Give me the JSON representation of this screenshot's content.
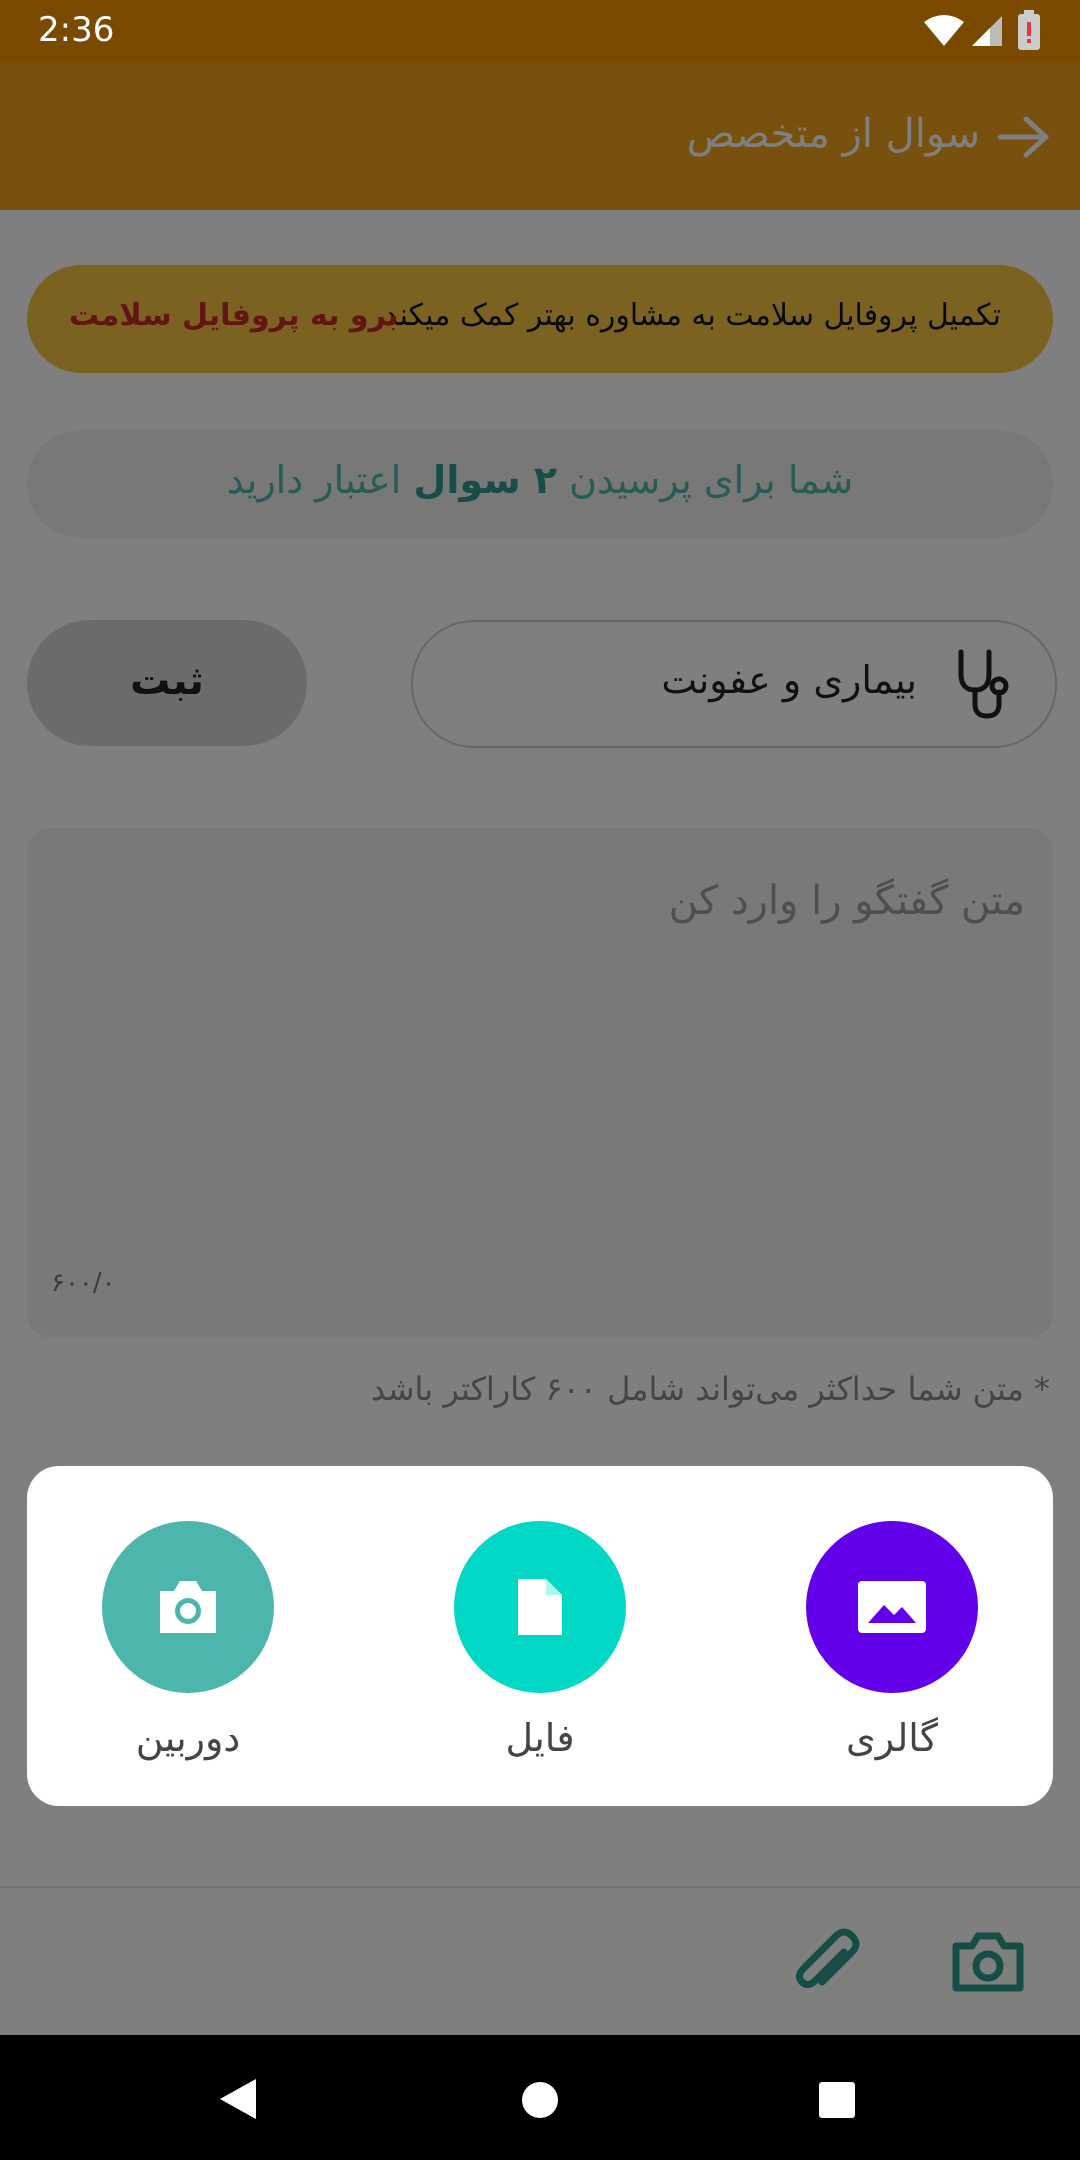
{
  "status_bar": {
    "time": "2:36"
  },
  "app_bar": {
    "title": "سوال از متخصص"
  },
  "profile_banner": {
    "message": "تکمیل پروفایل سلامت به مشاوره بهتر کمک میکند",
    "link": "برو به پروفایل سلامت"
  },
  "credit": {
    "prefix": "شما برای پرسیدن ",
    "count": "۲ سوال",
    "suffix": " اعتبار دارید"
  },
  "category": {
    "label": "بیماری و عفونت",
    "icon": "stethoscope-icon"
  },
  "submit": {
    "label": "ثبت"
  },
  "message_input": {
    "placeholder": "متن گفتگو را وارد کن",
    "counter": "۶۰۰/۰"
  },
  "hint": "* متن شما حداکثر می‌تواند شامل ۶۰۰ کاراکتر باشد",
  "attach_sheet": {
    "options": [
      {
        "label": "دوربین",
        "icon": "camera-icon",
        "color": "#4db6ac"
      },
      {
        "label": "فایل",
        "icon": "file-icon",
        "color": "#00d7c5"
      },
      {
        "label": "گالری",
        "icon": "image-icon",
        "color": "#6200ea"
      }
    ]
  },
  "colors": {
    "app_bar": "#f0a21d",
    "status_bar": "#7a4a00",
    "accent": "#2f9a8f",
    "banner": "#f6c542"
  }
}
